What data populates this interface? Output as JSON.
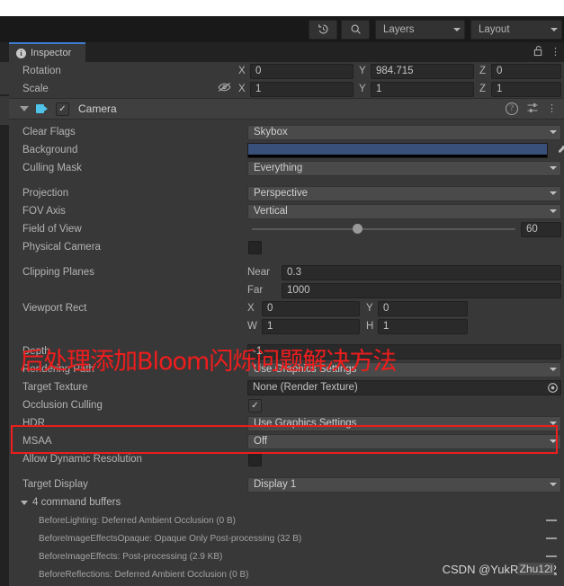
{
  "toolbar": {
    "history_icon": "history-undo-icon",
    "search_icon": "search-icon",
    "layers_label": "Layers",
    "layout_label": "Layout"
  },
  "inspector": {
    "tab_label": "Inspector",
    "info_glyph": "i",
    "lock_icon": "unlocked-padlock-icon",
    "menu_icon": "kebab-menu-icon"
  },
  "transform": {
    "rotation": {
      "label": "Rotation",
      "x_axis": "X",
      "x": "0",
      "y_axis": "Y",
      "y": "984.715",
      "z_axis": "Z",
      "z": "0"
    },
    "scale": {
      "label": "Scale",
      "lock_icon": "eye-slash-icon",
      "x_axis": "X",
      "x": "1",
      "y_axis": "Y",
      "y": "1",
      "z_axis": "Z",
      "z": "1"
    }
  },
  "camera": {
    "component_name": "Camera",
    "enabled": true,
    "enabled_glyph": "✓",
    "icon": "camera-icon",
    "help_icon": "help-icon",
    "preset_icon": "preset-icon",
    "menu_icon": "kebab-menu-icon",
    "properties": {
      "clear_flags": {
        "label": "Clear Flags",
        "value": "Skybox"
      },
      "background": {
        "label": "Background",
        "color": "#39507A",
        "eyedropper_icon": "eyedropper-icon"
      },
      "culling_mask": {
        "label": "Culling Mask",
        "value": "Everything"
      },
      "projection": {
        "label": "Projection",
        "value": "Perspective"
      },
      "fov_axis": {
        "label": "FOV Axis",
        "value": "Vertical"
      },
      "field_of_view": {
        "label": "Field of View",
        "value": "60",
        "slider_percent": 40
      },
      "physical_camera": {
        "label": "Physical Camera",
        "checked": false
      },
      "clipping_planes": {
        "label": "Clipping Planes",
        "near_label": "Near",
        "near": "0.3",
        "far_label": "Far",
        "far": "1000"
      },
      "viewport_rect": {
        "label": "Viewport Rect",
        "x_axis": "X",
        "x": "0",
        "y_axis": "Y",
        "y": "0",
        "w_axis": "W",
        "w": "1",
        "h_axis": "H",
        "h": "1"
      },
      "depth": {
        "label": "Depth",
        "value": "-1"
      },
      "rendering_path": {
        "label": "Rendering Path",
        "value": "Use Graphics Settings"
      },
      "target_texture": {
        "label": "Target Texture",
        "value": "None (Render Texture)",
        "picker_icon": "object-picker-icon"
      },
      "occlusion_culling": {
        "label": "Occlusion Culling",
        "checked": true,
        "check_glyph": "✓"
      },
      "hdr": {
        "label": "HDR",
        "value": "Use Graphics Settings"
      },
      "msaa": {
        "label": "MSAA",
        "value": "Off"
      },
      "allow_dynamic_resolution": {
        "label": "Allow Dynamic Resolution",
        "checked": false
      },
      "target_display": {
        "label": "Target Display",
        "value": "Display 1"
      }
    },
    "command_buffers": {
      "header": "4 command buffers",
      "items": [
        {
          "text": "BeforeLighting: Deferred Ambient Occlusion (0 B)",
          "remove_icon": "minus-icon"
        },
        {
          "text": "BeforeImageEffectsOpaque: Opaque Only Post-processing (32 B)",
          "remove_icon": "minus-icon"
        },
        {
          "text": "BeforeImageEffects: Post-processing (2.9 KB)",
          "remove_icon": "minus-icon"
        },
        {
          "text": "BeforeReflections: Deferred Ambient Occlusion (0 B)",
          "remove_icon": "minus-icon"
        }
      ]
    }
  },
  "annotations": {
    "title_text": "后处理添加Bloom闪烁问题解决方法",
    "highlight_color": "#EF1D1D",
    "watermark": "CSDN @YukRezhu12",
    "watermark_overlay": "Zhu12l"
  }
}
